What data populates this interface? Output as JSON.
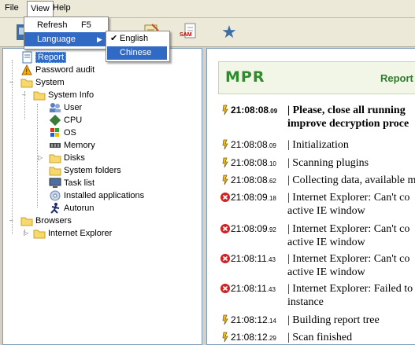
{
  "menubar": {
    "file": "File",
    "view": "View",
    "help": "Help"
  },
  "view_menu": {
    "refresh": "Refresh",
    "refresh_shortcut": "F5",
    "language": "Language"
  },
  "language_menu": {
    "english": "English",
    "chinese": "Chinese",
    "checked": "✔"
  },
  "toolbar": {
    "sam_label": "SAM"
  },
  "tree": {
    "report": "Report",
    "password_audit": "Password audit",
    "system": "System",
    "system_info": "System Info",
    "user": "User",
    "cpu": "CPU",
    "os": "OS",
    "memory": "Memory",
    "disks": "Disks",
    "system_folders": "System folders",
    "task_list": "Task list",
    "installed_apps": "Installed applications",
    "autorun": "Autorun",
    "browsers": "Browsers",
    "internet_explorer": "Internet Explorer"
  },
  "report": {
    "logo": "MPR",
    "title": "Report",
    "entries": [
      {
        "icon": "info-icon",
        "time": "21:08:08",
        "ms": ".09",
        "line1": "| Please, close all running",
        "line2": "improve decryption proce",
        "bold": true
      },
      {
        "icon": "info-icon",
        "time": "21:08:08",
        "ms": ".09",
        "line1": "| Initialization",
        "line2": ""
      },
      {
        "icon": "info-icon",
        "time": "21:08:08",
        "ms": ".10",
        "line1": "| Scanning plugins",
        "line2": ""
      },
      {
        "icon": "info-icon",
        "time": "21:08:08",
        "ms": ".62",
        "line1": "| Collecting data, available m",
        "line2": ""
      },
      {
        "icon": "error-icon",
        "time": "21:08:09",
        "ms": ".18",
        "line1": "| Internet Explorer: Can't co",
        "line2": "active IE window"
      },
      {
        "icon": "error-icon",
        "time": "21:08:09",
        "ms": ".92",
        "line1": "| Internet Explorer: Can't co",
        "line2": "active IE window"
      },
      {
        "icon": "error-icon",
        "time": "21:08:11",
        "ms": ".43",
        "line1": "| Internet Explorer: Can't co",
        "line2": "active IE window"
      },
      {
        "icon": "error-icon",
        "time": "21:08:11",
        "ms": ".43",
        "line1": "| Internet Explorer: Failed to",
        "line2": "instance"
      },
      {
        "icon": "info-icon",
        "time": "21:08:12",
        "ms": ".14",
        "line1": "| Building report tree",
        "line2": ""
      },
      {
        "icon": "info-icon",
        "time": "21:08:12",
        "ms": ".29",
        "line1": "| Scan finished",
        "line2": ""
      }
    ]
  },
  "colors": {
    "accent": "#316ac5",
    "logo_green": "#2e8b2e",
    "error_red": "#d42020"
  }
}
